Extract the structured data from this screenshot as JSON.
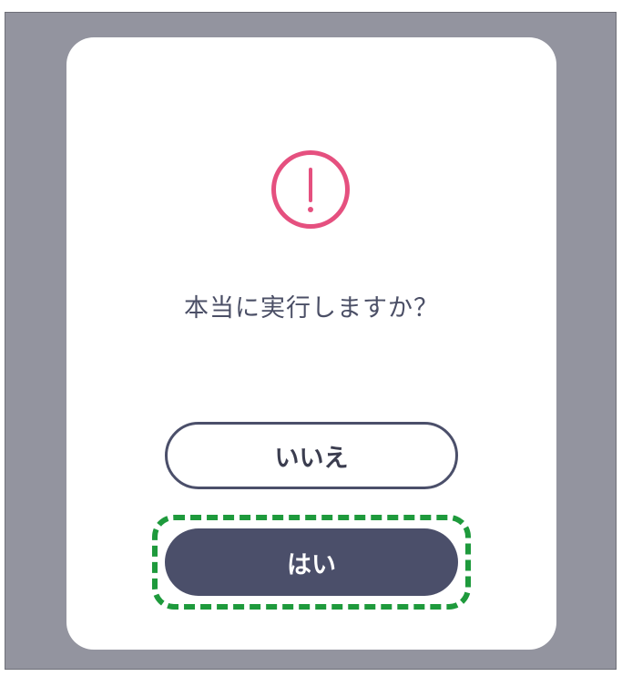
{
  "dialog": {
    "icon": "exclamation-circle-icon",
    "message": "本当に実行しますか？",
    "cancel_label": "いいえ",
    "confirm_label": "はい"
  },
  "colors": {
    "backdrop": "#93949f",
    "accent_icon": "#e5507f",
    "primary_button": "#4b4f6a",
    "highlight": "#1e9a3c",
    "text": "#4b4f66"
  }
}
